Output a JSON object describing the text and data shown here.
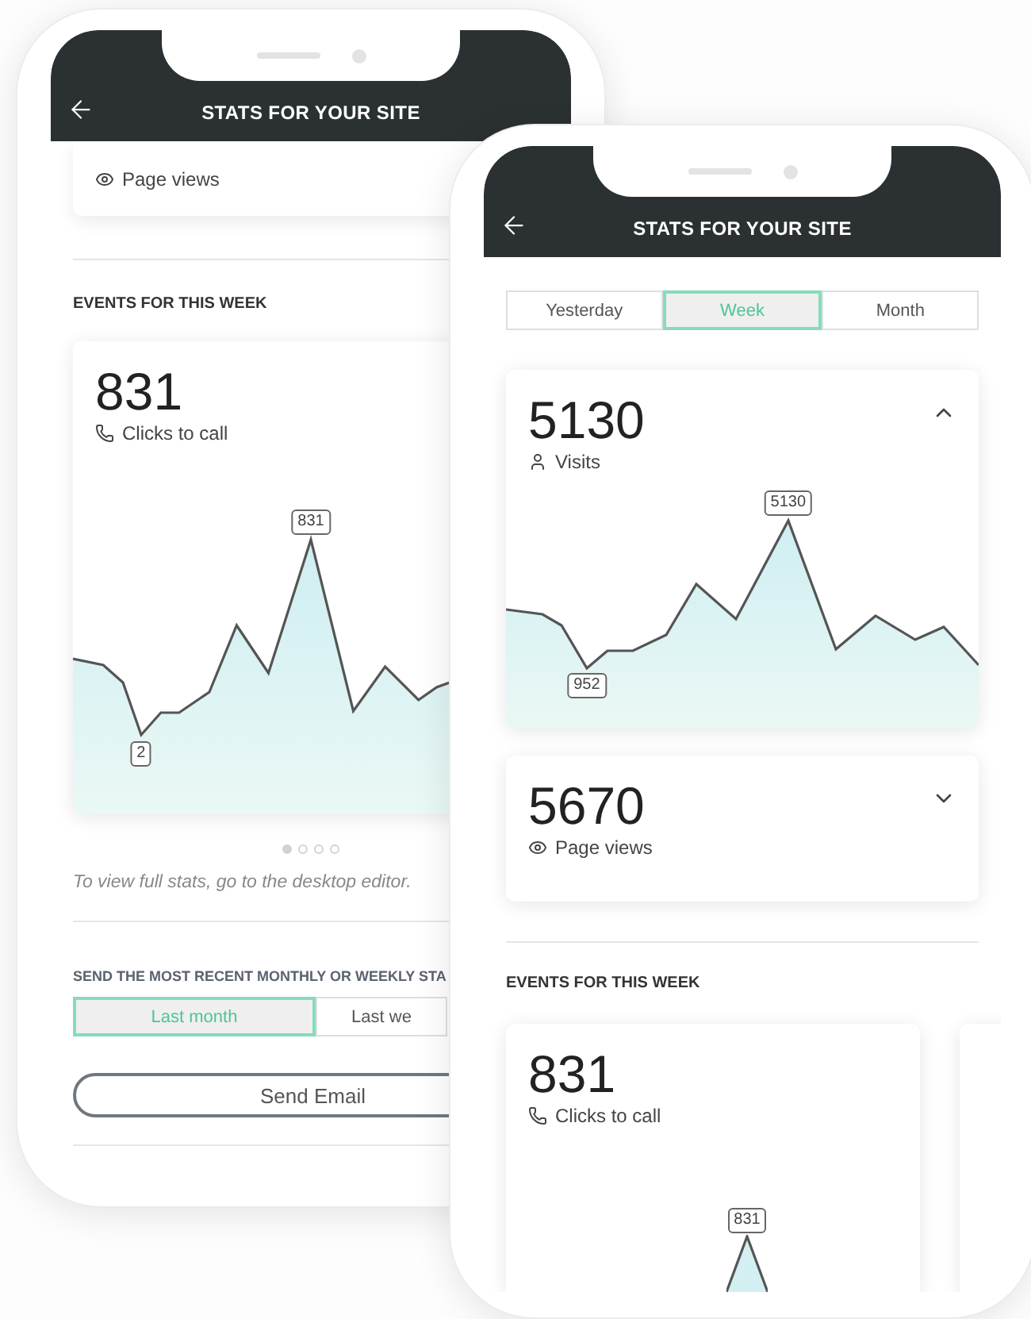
{
  "back_phone": {
    "title": "STATS FOR YOUR SITE",
    "page_views_card": {
      "label": "Page views"
    },
    "events": {
      "heading": "EVENTS FOR THIS WEEK",
      "card": {
        "value": "831",
        "label": "Clicks to call",
        "peak_label": "831",
        "low_label": "2"
      },
      "pager": [
        {
          "selected": true
        },
        {
          "selected": false
        },
        {
          "selected": false
        },
        {
          "selected": false
        }
      ],
      "note": "To view full stats, go to the desktop editor."
    },
    "send": {
      "heading": "SEND THE MOST RECENT MONTHLY OR WEEKLY STA",
      "options": [
        {
          "label": "Last month",
          "selected": true
        },
        {
          "label": "Last we",
          "selected": false
        }
      ],
      "button": "Send Email"
    }
  },
  "front_phone": {
    "title": "STATS FOR YOUR SITE",
    "periods": [
      {
        "label": "Yesterday",
        "selected": false
      },
      {
        "label": "Week",
        "selected": true
      },
      {
        "label": "Month",
        "selected": false
      }
    ],
    "stats": [
      {
        "kind": "visits",
        "value": "5130",
        "label": "Visits",
        "expanded": true,
        "peak_label": "5130",
        "low_label": "952"
      },
      {
        "kind": "views",
        "value": "5670",
        "label": "Page views",
        "expanded": false
      }
    ],
    "events": {
      "heading": "EVENTS FOR THIS WEEK",
      "card": {
        "value": "831",
        "label": "Clicks to call",
        "peak_label": "831"
      }
    }
  }
}
